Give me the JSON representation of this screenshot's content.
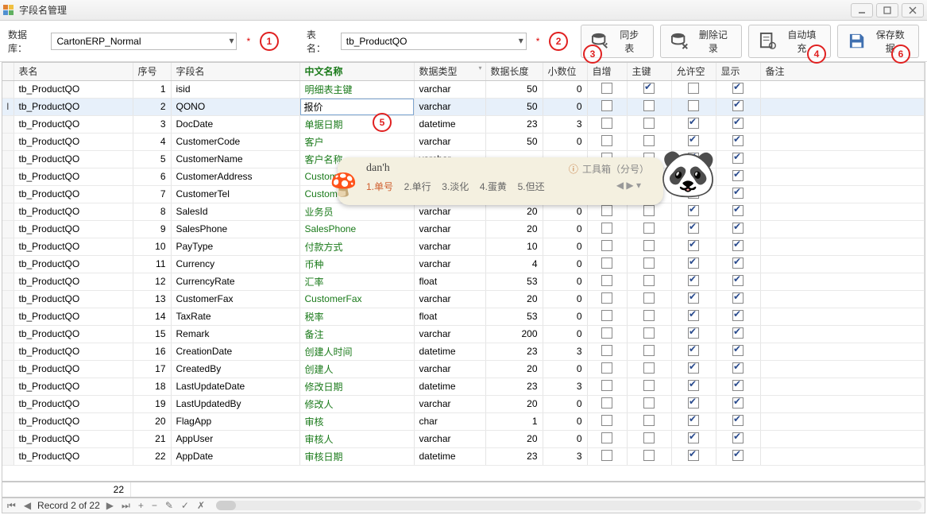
{
  "window": {
    "title": "字段名管理"
  },
  "toolbar": {
    "db_label": "数据库：",
    "db_value": "CartonERP_Normal",
    "table_label": "表名：",
    "table_value": "tb_ProductQO",
    "sync_label": "同步表",
    "delete_label": "删除记录",
    "autofill_label": "自动填充",
    "save_label": "保存数据"
  },
  "callouts": {
    "c1": "1",
    "c2": "2",
    "c3": "3",
    "c4": "4",
    "c5": "5",
    "c6": "6"
  },
  "columns": {
    "indicator": "",
    "table": "表名",
    "ord": "序号",
    "field": "字段名",
    "cn": "中文名称",
    "dtype": "数据类型",
    "len": "数据长度",
    "dec": "小数位",
    "auto": "自增",
    "pk": "主键",
    "null": "允许空",
    "show": "显示",
    "remark": "备注"
  },
  "editing_value": "报价",
  "rows": [
    {
      "ord": 1,
      "field": "isid",
      "cn": "明细表主键",
      "dtype": "varchar",
      "len": 50,
      "dec": 0,
      "auto": false,
      "pk": true,
      "null": false,
      "show": true
    },
    {
      "ord": 2,
      "field": "QONO",
      "cn": "报价",
      "dtype": "varchar",
      "len": 50,
      "dec": 0,
      "auto": false,
      "pk": false,
      "null": false,
      "show": true,
      "selected": true,
      "edit_cn": true,
      "ind": "I"
    },
    {
      "ord": 3,
      "field": "DocDate",
      "cn": "单据日期",
      "dtype": "datetime",
      "len": 23,
      "dec": 3,
      "auto": false,
      "pk": false,
      "null": true,
      "show": true
    },
    {
      "ord": 4,
      "field": "CustomerCode",
      "cn": "客户",
      "dtype": "varchar",
      "len": 50,
      "dec": 0,
      "auto": false,
      "pk": false,
      "null": true,
      "show": true
    },
    {
      "ord": 5,
      "field": "CustomerName",
      "cn": "客户名称",
      "dtype": "varchar",
      "len": "",
      "dec": "",
      "auto": false,
      "pk": false,
      "null": true,
      "show": true
    },
    {
      "ord": 6,
      "field": "CustomerAddress",
      "cn": "CustomerAddress",
      "dtype": "",
      "len": "",
      "dec": "",
      "auto": false,
      "pk": false,
      "null": true,
      "show": true
    },
    {
      "ord": 7,
      "field": "CustomerTel",
      "cn": "CustomerTel",
      "dtype": "",
      "len": "",
      "dec": "",
      "auto": false,
      "pk": false,
      "null": true,
      "show": true
    },
    {
      "ord": 8,
      "field": "SalesId",
      "cn": "业务员",
      "dtype": "varchar",
      "len": 20,
      "dec": 0,
      "auto": false,
      "pk": false,
      "null": true,
      "show": true
    },
    {
      "ord": 9,
      "field": "SalesPhone",
      "cn": "SalesPhone",
      "dtype": "varchar",
      "len": 20,
      "dec": 0,
      "auto": false,
      "pk": false,
      "null": true,
      "show": true
    },
    {
      "ord": 10,
      "field": "PayType",
      "cn": "付款方式",
      "dtype": "varchar",
      "len": 10,
      "dec": 0,
      "auto": false,
      "pk": false,
      "null": true,
      "show": true
    },
    {
      "ord": 11,
      "field": "Currency",
      "cn": "币种",
      "dtype": "varchar",
      "len": 4,
      "dec": 0,
      "auto": false,
      "pk": false,
      "null": true,
      "show": true
    },
    {
      "ord": 12,
      "field": "CurrencyRate",
      "cn": "汇率",
      "dtype": "float",
      "len": 53,
      "dec": 0,
      "auto": false,
      "pk": false,
      "null": true,
      "show": true
    },
    {
      "ord": 13,
      "field": "CustomerFax",
      "cn": "CustomerFax",
      "dtype": "varchar",
      "len": 20,
      "dec": 0,
      "auto": false,
      "pk": false,
      "null": true,
      "show": true
    },
    {
      "ord": 14,
      "field": "TaxRate",
      "cn": "税率",
      "dtype": "float",
      "len": 53,
      "dec": 0,
      "auto": false,
      "pk": false,
      "null": true,
      "show": true
    },
    {
      "ord": 15,
      "field": "Remark",
      "cn": "备注",
      "dtype": "varchar",
      "len": 200,
      "dec": 0,
      "auto": false,
      "pk": false,
      "null": true,
      "show": true
    },
    {
      "ord": 16,
      "field": "CreationDate",
      "cn": "创建人时间",
      "dtype": "datetime",
      "len": 23,
      "dec": 3,
      "auto": false,
      "pk": false,
      "null": true,
      "show": true
    },
    {
      "ord": 17,
      "field": "CreatedBy",
      "cn": "创建人",
      "dtype": "varchar",
      "len": 20,
      "dec": 0,
      "auto": false,
      "pk": false,
      "null": true,
      "show": true
    },
    {
      "ord": 18,
      "field": "LastUpdateDate",
      "cn": "修改日期",
      "dtype": "datetime",
      "len": 23,
      "dec": 3,
      "auto": false,
      "pk": false,
      "null": true,
      "show": true
    },
    {
      "ord": 19,
      "field": "LastUpdatedBy",
      "cn": "修改人",
      "dtype": "varchar",
      "len": 20,
      "dec": 0,
      "auto": false,
      "pk": false,
      "null": true,
      "show": true
    },
    {
      "ord": 20,
      "field": "FlagApp",
      "cn": "审核",
      "dtype": "char",
      "len": 1,
      "dec": 0,
      "auto": false,
      "pk": false,
      "null": true,
      "show": true
    },
    {
      "ord": 21,
      "field": "AppUser",
      "cn": "审核人",
      "dtype": "varchar",
      "len": 20,
      "dec": 0,
      "auto": false,
      "pk": false,
      "null": true,
      "show": true
    },
    {
      "ord": 22,
      "field": "AppDate",
      "cn": "审核日期",
      "dtype": "datetime",
      "len": 23,
      "dec": 3,
      "auto": false,
      "pk": false,
      "null": true,
      "show": true
    }
  ],
  "row_table_name": "tb_ProductQO",
  "status": {
    "count": "22",
    "nav": "Record 2 of 22"
  },
  "ime": {
    "typed": "dan'h",
    "toolbox": "工具箱（分号）",
    "opts": [
      "1.单号",
      "2.单行",
      "3.淡化",
      "4.蛋黄",
      "5.但还"
    ]
  }
}
